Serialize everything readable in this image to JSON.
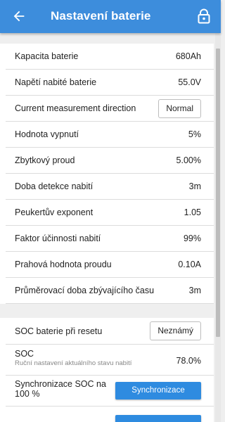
{
  "header": {
    "title": "Nastavení baterie",
    "back_icon": "arrow-back-icon",
    "lock_icon": "lock-icon",
    "color": "#3d8ddc"
  },
  "group1": [
    {
      "label": "Kapacita baterie",
      "value": "680Ah"
    },
    {
      "label": "Napětí nabité baterie",
      "value": "55.0V"
    },
    {
      "label": "Current measurement direction",
      "button": "Normal"
    },
    {
      "label": "Hodnota vypnutí",
      "value": "5%"
    },
    {
      "label": "Zbytkový proud",
      "value": "5.00%"
    },
    {
      "label": "Doba detekce nabití",
      "value": "3m"
    },
    {
      "label": "Peukertův exponent",
      "value": "1.05"
    },
    {
      "label": "Faktor účinnosti nabití",
      "value": "99%"
    },
    {
      "label": "Prahová hodnota proudu",
      "value": "0.10A"
    },
    {
      "label": "Průměrovací doba zbývajícího času",
      "value": "3m"
    }
  ],
  "group2": {
    "soc_reset": {
      "label": "SOC baterie při resetu",
      "button": "Neznámý"
    },
    "soc": {
      "label": "SOC",
      "sub": "Ruční nastavení aktuálního stavu nabití",
      "value": "78.0%"
    },
    "sync": {
      "label": "Synchronizace SOC na 100 %",
      "button": "Synchronizace"
    }
  },
  "colors": {
    "accent_button": "#2e8be0",
    "background": "#efefef"
  }
}
